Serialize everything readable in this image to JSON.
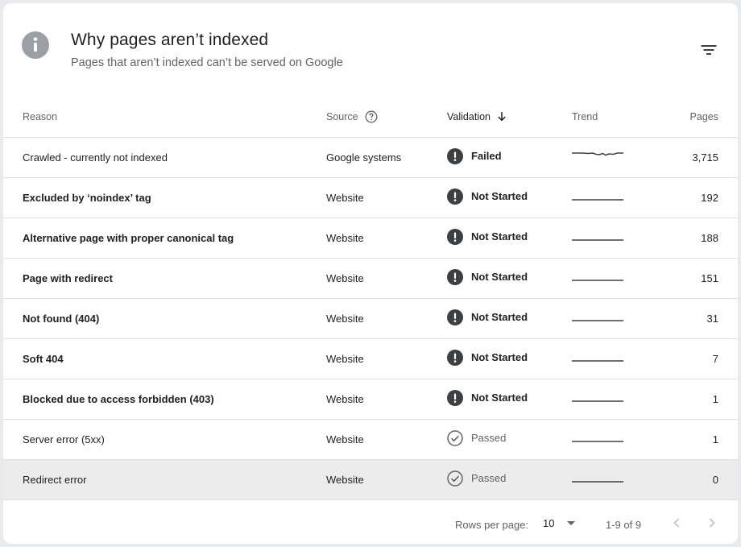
{
  "header": {
    "title": "Why pages aren’t indexed",
    "subtitle": "Pages that aren’t indexed can’t be served on Google",
    "icon": "info-icon",
    "filter_icon": "filter-icon"
  },
  "columns": {
    "reason": "Reason",
    "source": "Source",
    "validation": "Validation",
    "trend": "Trend",
    "pages": "Pages"
  },
  "colors": {
    "failed_icon": "#3c4043",
    "passed_icon": "#5f6368",
    "highlight_row": "#ececec",
    "divider": "#e0e0e0"
  },
  "rows": [
    {
      "reason": "Crawled - currently not indexed",
      "source": "Google systems",
      "validation": "Failed",
      "status": "failed",
      "pages": "3,715",
      "bold": false
    },
    {
      "reason": "Excluded by ‘noindex’ tag",
      "source": "Website",
      "validation": "Not Started",
      "status": "failed",
      "pages": "192",
      "bold": true
    },
    {
      "reason": "Alternative page with proper canonical tag",
      "source": "Website",
      "validation": "Not Started",
      "status": "failed",
      "pages": "188",
      "bold": true
    },
    {
      "reason": "Page with redirect",
      "source": "Website",
      "validation": "Not Started",
      "status": "failed",
      "pages": "151",
      "bold": true
    },
    {
      "reason": "Not found (404)",
      "source": "Website",
      "validation": "Not Started",
      "status": "failed",
      "pages": "31",
      "bold": true
    },
    {
      "reason": "Soft 404",
      "source": "Website",
      "validation": "Not Started",
      "status": "failed",
      "pages": "7",
      "bold": true
    },
    {
      "reason": "Blocked due to access forbidden (403)",
      "source": "Website",
      "validation": "Not Started",
      "status": "failed",
      "pages": "1",
      "bold": true
    },
    {
      "reason": "Server error (5xx)",
      "source": "Website",
      "validation": "Passed",
      "status": "passed",
      "pages": "1",
      "bold": false
    },
    {
      "reason": "Redirect error",
      "source": "Website",
      "validation": "Passed",
      "status": "passed",
      "pages": "0",
      "bold": false
    }
  ],
  "footer": {
    "rows_per_page_label": "Rows per page:",
    "rows_per_page_value": "10",
    "range": "1-9 of 9"
  }
}
